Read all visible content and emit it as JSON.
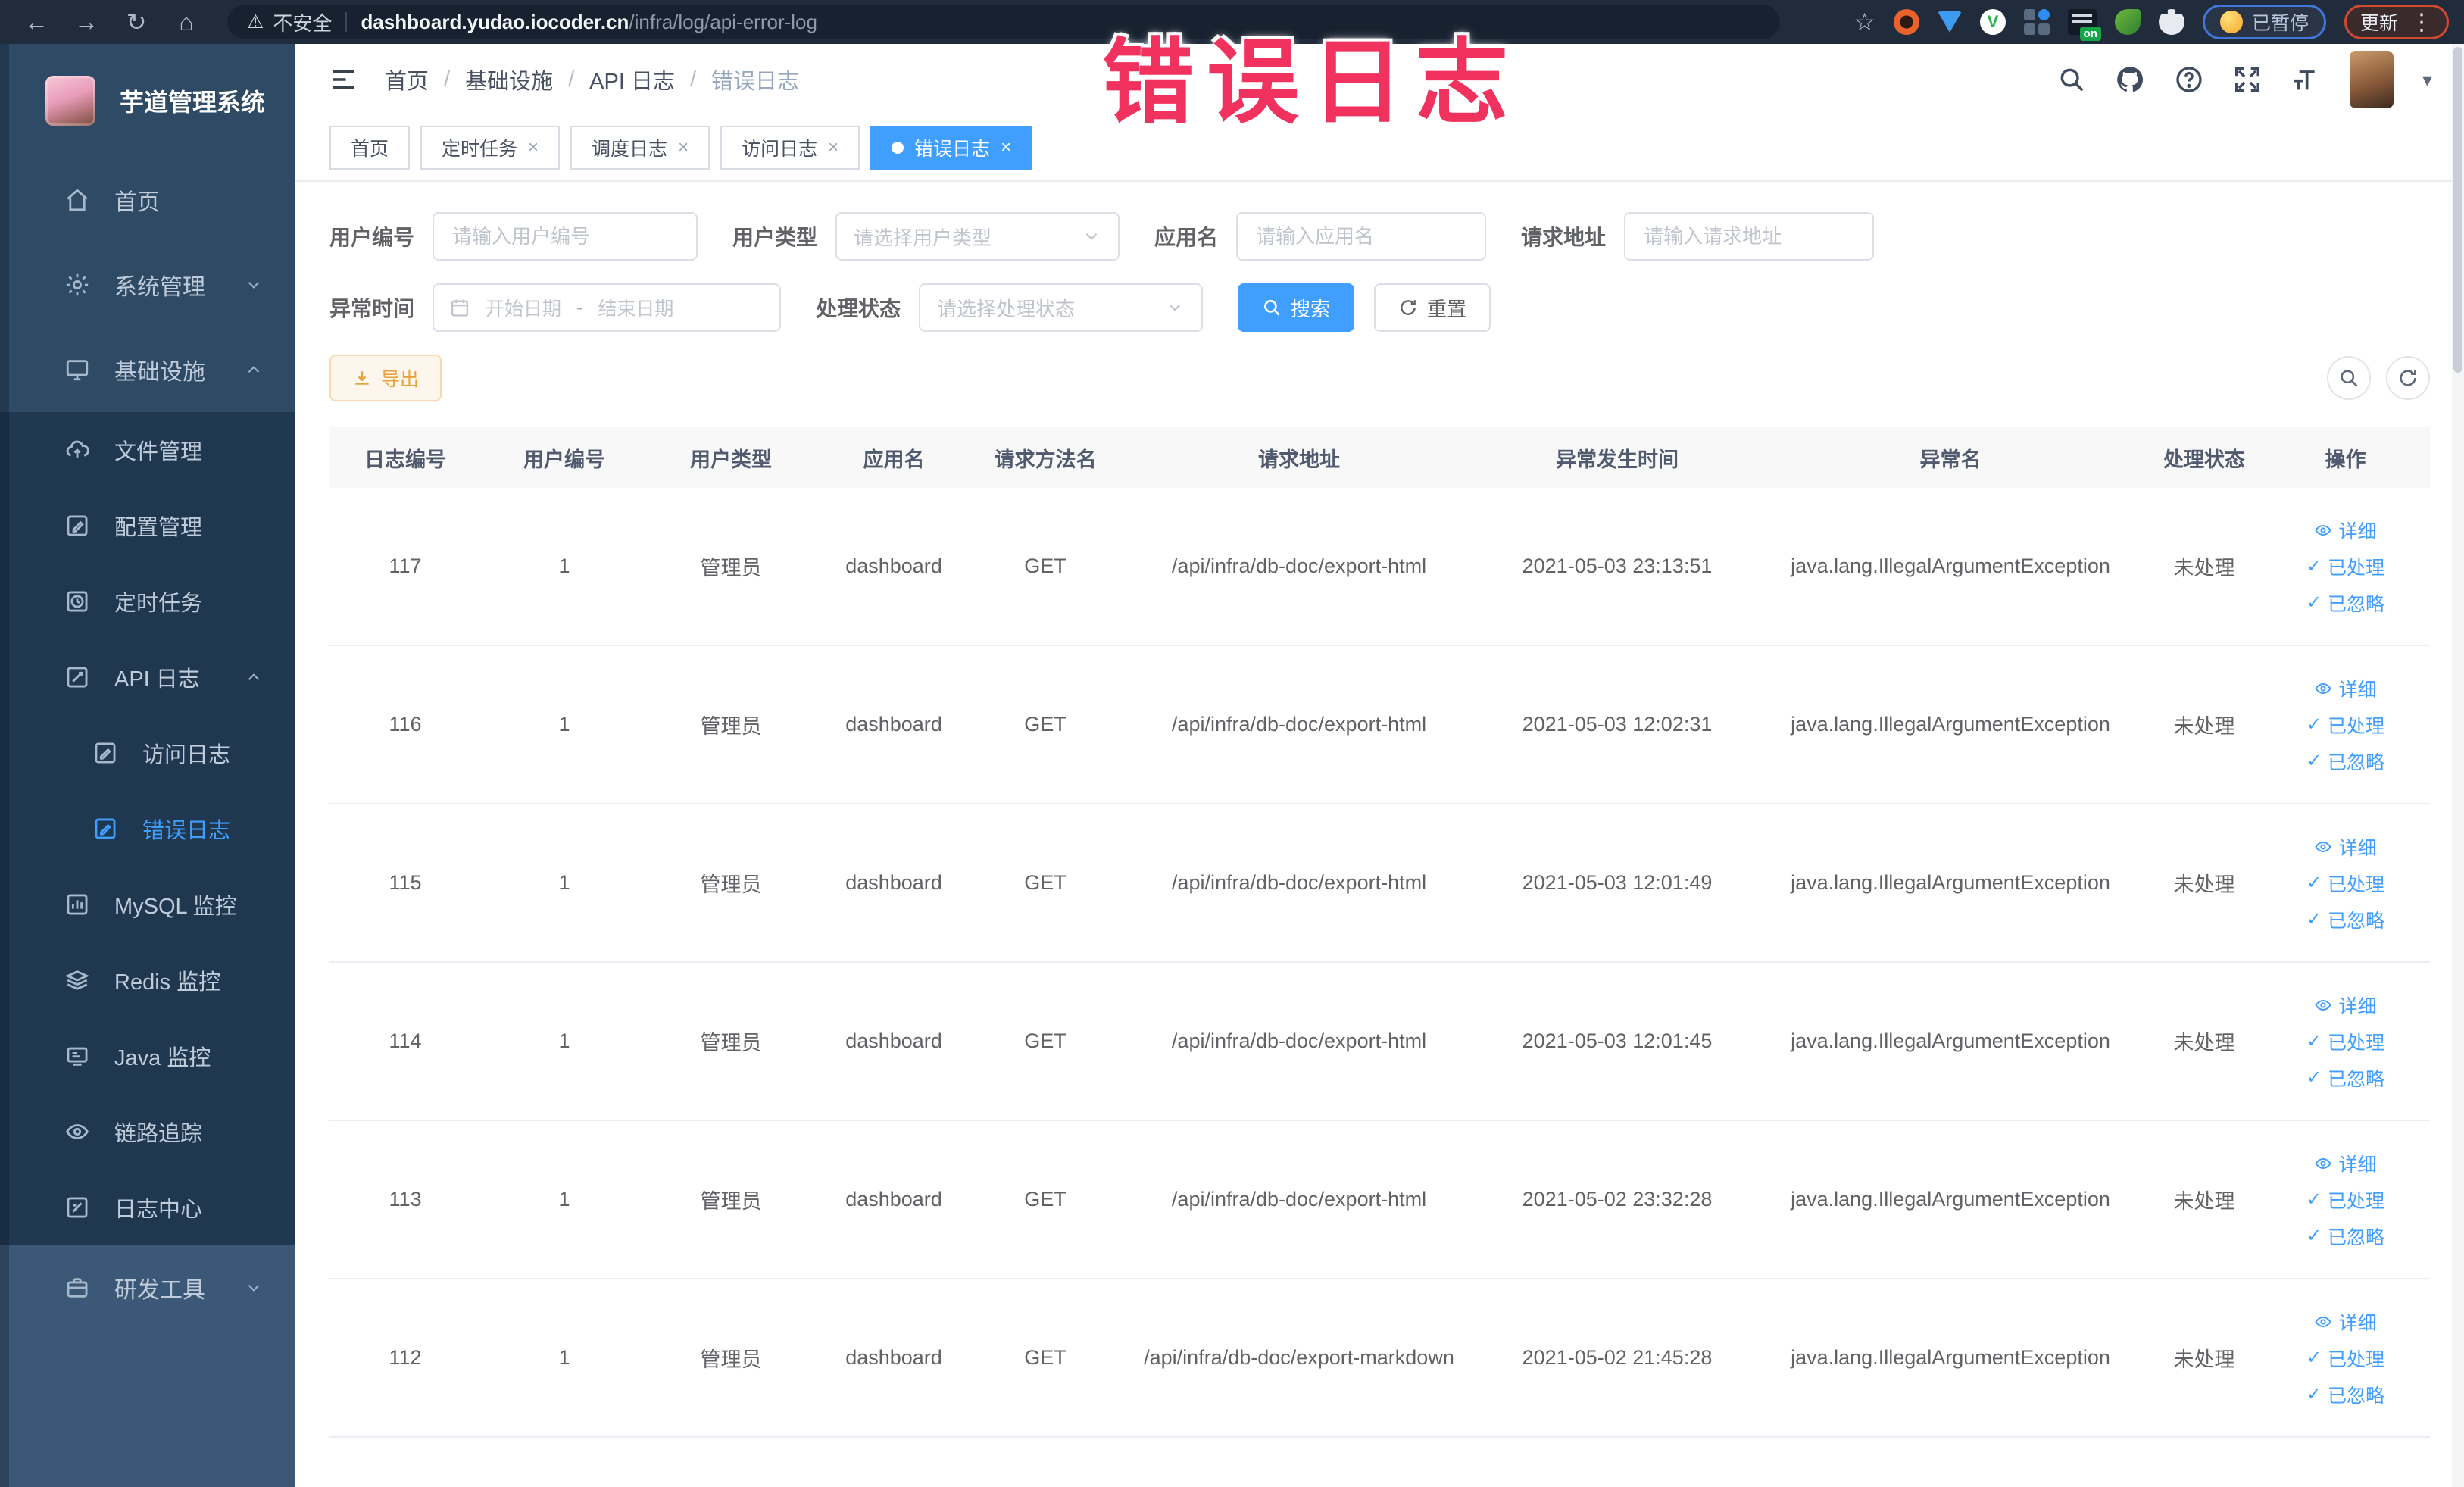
{
  "watermark": "错误日志",
  "icons": {
    "back": "←",
    "forward": "→",
    "reload": "↻",
    "home": "⌂",
    "warning": "⚠",
    "star": "☆",
    "kebab": "⋮",
    "caret_down": "▾",
    "check": "✓",
    "close": "×"
  },
  "browser": {
    "security_label": "不安全",
    "url_host": "dashboard.yudao.iocoder.cn",
    "url_path": "/infra/log/api-error-log",
    "on_badge": "on",
    "paused_label": "已暂停",
    "update_label": "更新"
  },
  "sidebar": {
    "app_title": "芋道管理系统",
    "items": [
      {
        "label": "首页"
      },
      {
        "label": "系统管理"
      },
      {
        "label": "基础设施"
      },
      {
        "label": "文件管理"
      },
      {
        "label": "配置管理"
      },
      {
        "label": "定时任务"
      },
      {
        "label": "API 日志"
      },
      {
        "label": "访问日志"
      },
      {
        "label": "错误日志"
      },
      {
        "label": "MySQL 监控"
      },
      {
        "label": "Redis 监控"
      },
      {
        "label": "Java 监控"
      },
      {
        "label": "链路追踪"
      },
      {
        "label": "日志中心"
      },
      {
        "label": "研发工具"
      }
    ]
  },
  "header": {
    "breadcrumb": [
      "首页",
      "基础设施",
      "API 日志",
      "错误日志"
    ]
  },
  "tabs": [
    {
      "label": "首页"
    },
    {
      "label": "定时任务"
    },
    {
      "label": "调度日志"
    },
    {
      "label": "访问日志"
    },
    {
      "label": "错误日志"
    }
  ],
  "filters": {
    "user_id_label": "用户编号",
    "user_id_placeholder": "请输入用户编号",
    "user_type_label": "用户类型",
    "user_type_placeholder": "请选择用户类型",
    "app_name_label": "应用名",
    "app_name_placeholder": "请输入应用名",
    "request_url_label": "请求地址",
    "request_url_placeholder": "请输入请求地址",
    "exception_time_label": "异常时间",
    "date_start_placeholder": "开始日期",
    "date_separator": "-",
    "date_end_placeholder": "结束日期",
    "process_status_label": "处理状态",
    "process_status_placeholder": "请选择处理状态",
    "search_label": "搜索",
    "reset_label": "重置"
  },
  "toolbar": {
    "export_label": "导出"
  },
  "table": {
    "columns": [
      "日志编号",
      "用户编号",
      "用户类型",
      "应用名",
      "请求方法名",
      "请求地址",
      "异常发生时间",
      "异常名",
      "处理状态",
      "操作"
    ],
    "action_detail": "详细",
    "action_processed": "已处理",
    "action_ignored": "已忽略",
    "rows": [
      {
        "log_id": "117",
        "user_id": "1",
        "user_type": "管理员",
        "app_name": "dashboard",
        "method": "GET",
        "url": "/api/infra/db-doc/export-html",
        "time": "2021-05-03 23:13:51",
        "exception": "java.lang.IllegalArgumentException",
        "status": "未处理"
      },
      {
        "log_id": "116",
        "user_id": "1",
        "user_type": "管理员",
        "app_name": "dashboard",
        "method": "GET",
        "url": "/api/infra/db-doc/export-html",
        "time": "2021-05-03 12:02:31",
        "exception": "java.lang.IllegalArgumentException",
        "status": "未处理"
      },
      {
        "log_id": "115",
        "user_id": "1",
        "user_type": "管理员",
        "app_name": "dashboard",
        "method": "GET",
        "url": "/api/infra/db-doc/export-html",
        "time": "2021-05-03 12:01:49",
        "exception": "java.lang.IllegalArgumentException",
        "status": "未处理"
      },
      {
        "log_id": "114",
        "user_id": "1",
        "user_type": "管理员",
        "app_name": "dashboard",
        "method": "GET",
        "url": "/api/infra/db-doc/export-html",
        "time": "2021-05-03 12:01:45",
        "exception": "java.lang.IllegalArgumentException",
        "status": "未处理"
      },
      {
        "log_id": "113",
        "user_id": "1",
        "user_type": "管理员",
        "app_name": "dashboard",
        "method": "GET",
        "url": "/api/infra/db-doc/export-html",
        "time": "2021-05-02 23:32:28",
        "exception": "java.lang.IllegalArgumentException",
        "status": "未处理"
      },
      {
        "log_id": "112",
        "user_id": "1",
        "user_type": "管理员",
        "app_name": "dashboard",
        "method": "GET",
        "url": "/api/infra/db-doc/export-markdown",
        "time": "2021-05-02 21:45:28",
        "exception": "java.lang.IllegalArgumentException",
        "status": "未处理"
      }
    ]
  },
  "colors": {
    "accent": "#409EFF",
    "warning": "#E6A23C",
    "watermark": "#F1315E",
    "sidebar_bg": "#2F4A65",
    "sidebar_sub_bg": "#1F3850",
    "sidebar_bottom_bg": "#3C5878",
    "browser_bar_bg": "#202B3C"
  }
}
